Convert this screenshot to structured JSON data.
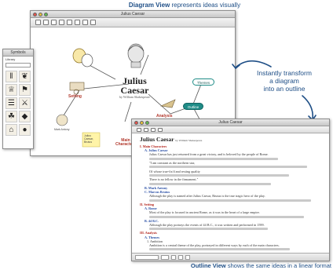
{
  "captions": {
    "top_bold": "Diagram View",
    "top_rest": " represents ideas visually",
    "bottom_bold": "Outline View",
    "bottom_rest": " shows the same ideas in a linear format",
    "callout_line1": "Instantly transform",
    "callout_line2": "a diagram",
    "callout_line3": "into an outline"
  },
  "diagram_window": {
    "title": "Julius Caesar",
    "center_title": "Julius",
    "center_title_2": "Caesar",
    "center_subtitle": "by William Shakespeare",
    "nodes": {
      "setting": "Setting",
      "analysis": "Analysis",
      "main_chars": "Main Characters",
      "mark_antony": "Mark Antony",
      "themes": "Themes",
      "outline": "Outline",
      "note_text": "Julius Caesar, Brutus"
    }
  },
  "symbols_window": {
    "title": "Symbols",
    "tab_label": "Library"
  },
  "outline_window": {
    "title": "Julius Caesar",
    "doc_title": "Julius Caesar",
    "doc_byline": "by William Shakespeare",
    "lines": [
      {
        "kind": "h1",
        "text": "I. Main Characters"
      },
      {
        "kind": "h2",
        "text": "A. Julius Caesar"
      },
      {
        "kind": "p",
        "text": "Julius Caesar has just returned from a great victory, and is beloved by the people of Rome."
      },
      {
        "kind": "p",
        "text": "\"I am constant as the northern star,"
      },
      {
        "kind": "p",
        "text": "Of whose true-fix'd and resting quality"
      },
      {
        "kind": "p",
        "text": "There is no fellow in the firmament.\""
      },
      {
        "kind": "h2",
        "text": "B. Mark Antony"
      },
      {
        "kind": "h2",
        "text": "C. Marcus Brutus"
      },
      {
        "kind": "p",
        "text": "Although the play is named after Julius Caesar, Brutus is the true tragic hero of the play."
      },
      {
        "kind": "h1",
        "text": "II. Setting"
      },
      {
        "kind": "h2",
        "text": "A. Rome"
      },
      {
        "kind": "p",
        "text": "Most of the play is focused in ancient Rome, as it was in the heart of a large empire."
      },
      {
        "kind": "h2",
        "text": "B. 44 B.C."
      },
      {
        "kind": "p",
        "text": "Although the play portrays the events of 44 B.C., it was written and performed in 1599."
      },
      {
        "kind": "h1",
        "text": "III. Analysis"
      },
      {
        "kind": "h2",
        "text": "A. Themes"
      },
      {
        "kind": "sub",
        "text": "1. Ambition"
      },
      {
        "kind": "p",
        "text": "Ambition is a central theme of the play, portrayed in different ways by each of the main characters."
      },
      {
        "kind": "sub",
        "text": "2. Honor"
      }
    ]
  },
  "colors": {
    "caption": "#1e4e86",
    "heading_red": "#b3261e",
    "heading_blue": "#2a4fa5",
    "node_teal": "#1f8c87"
  }
}
